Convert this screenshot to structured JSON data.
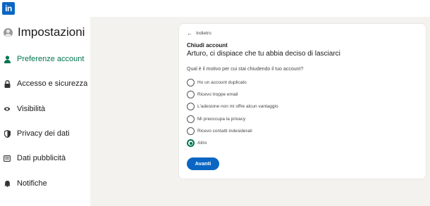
{
  "brand": {
    "logo_text": "in",
    "color": "#0a66c2"
  },
  "sidebar": {
    "title": "Impostazioni",
    "items": [
      {
        "label": "Preferenze account",
        "icon": "person-icon",
        "active": true
      },
      {
        "label": "Accesso e sicurezza",
        "icon": "lock-icon",
        "active": false
      },
      {
        "label": "Visibilità",
        "icon": "eye-icon",
        "active": false
      },
      {
        "label": "Privacy dei dati",
        "icon": "shield-icon",
        "active": false
      },
      {
        "label": "Dati pubblicità",
        "icon": "newspaper-icon",
        "active": false
      },
      {
        "label": "Notifiche",
        "icon": "bell-icon",
        "active": false
      }
    ]
  },
  "card": {
    "back_label": "Indietro",
    "section_title": "Chiudi account",
    "headline": "Arturo, ci dispiace che tu abbia deciso di lasciarci",
    "question": "Qual è il motivo per cui stai chiudendo il tuo account?",
    "options": [
      "Ho un account duplicato",
      "Ricevo troppe email",
      "L'adesione non mi offre alcun vantaggio",
      "Mi preoccupa la privacy",
      "Ricevo contatti indesiderati",
      "Altro"
    ],
    "selected_option": "Altro",
    "next_button": "Avanti"
  },
  "colors": {
    "accent_green": "#01754f",
    "button_blue": "#0a66c2",
    "background": "#f4f2ee"
  }
}
